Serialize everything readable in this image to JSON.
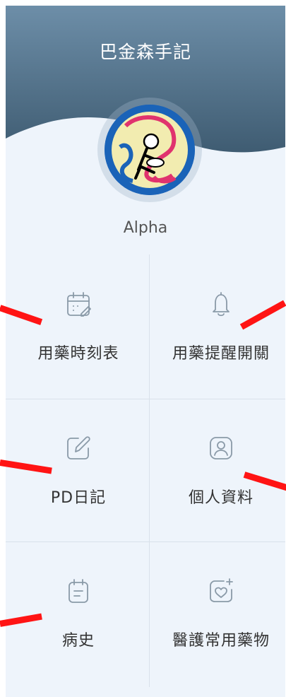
{
  "app": {
    "title": "巴金森手記"
  },
  "user": {
    "name": "Alpha"
  },
  "menu": [
    {
      "label": "用藥時刻表",
      "icon": "calendar-edit-icon"
    },
    {
      "label": "用藥提醒開關",
      "icon": "bell-icon"
    },
    {
      "label": "PD日記",
      "icon": "edit-note-icon"
    },
    {
      "label": "個人資料",
      "icon": "user-profile-icon"
    },
    {
      "label": "病史",
      "icon": "calendar-list-icon"
    },
    {
      "label": "醫護常用藥物",
      "icon": "heart-add-icon"
    }
  ],
  "colors": {
    "header_top": "#6d8ea8",
    "header_bottom": "#3f5c72",
    "background": "#eef4fb",
    "annotation": "#ff1414"
  }
}
